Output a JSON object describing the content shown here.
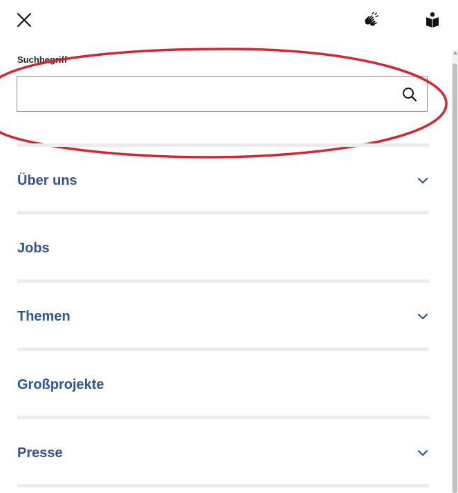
{
  "header": {
    "close_icon": "close-icon",
    "sign_language_icon": "sign-language-icon",
    "easy_language_icon": "easy-language-icon"
  },
  "search": {
    "label": "Suchbegriff",
    "value": "",
    "placeholder": "",
    "icon": "search-icon"
  },
  "nav": {
    "items": [
      {
        "label": "Über uns",
        "has_submenu": true
      },
      {
        "label": "Jobs",
        "has_submenu": false
      },
      {
        "label": "Themen",
        "has_submenu": true
      },
      {
        "label": "Großprojekte",
        "has_submenu": false
      },
      {
        "label": "Presse",
        "has_submenu": true
      }
    ]
  },
  "colors": {
    "nav_text": "#2f5597",
    "annotation": "#d9232e",
    "divider": "#ececec"
  }
}
